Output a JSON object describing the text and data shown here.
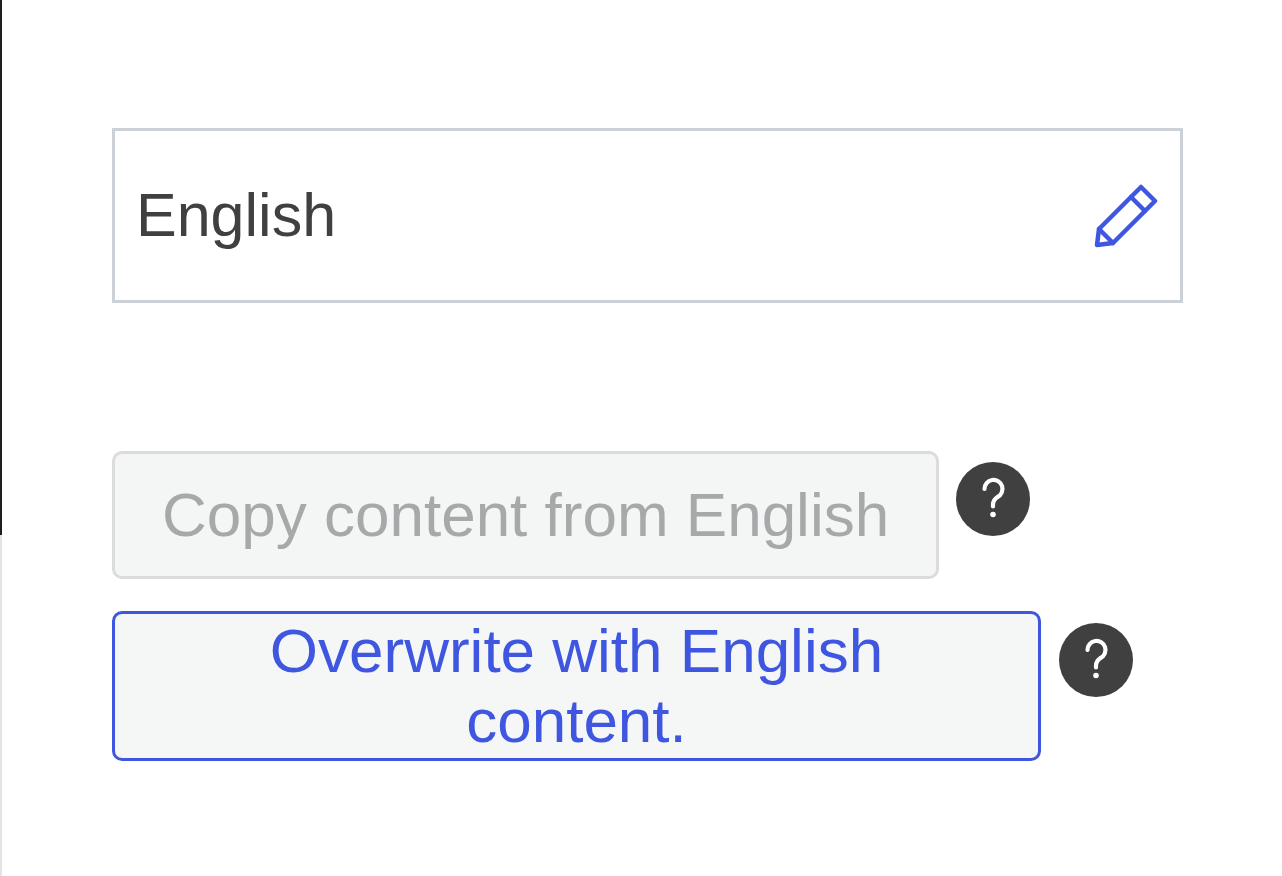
{
  "language_field": {
    "value": "English"
  },
  "actions": [
    {
      "label": "Copy content from English",
      "disabled": true
    },
    {
      "label": "Overwrite with English content.",
      "disabled": false
    }
  ]
}
